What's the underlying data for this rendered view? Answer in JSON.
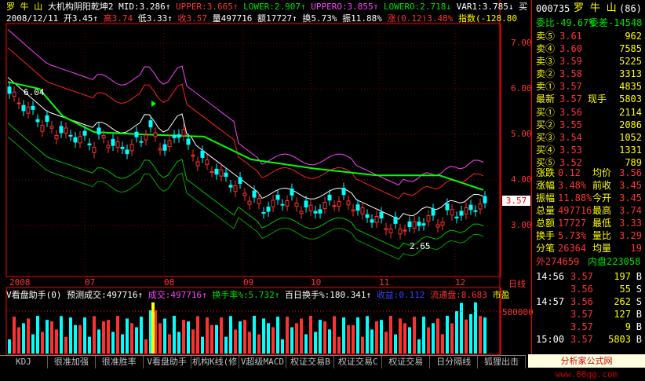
{
  "header": {
    "stock": "罗 牛 山",
    "indicator": "大机构阴阳乾坤2",
    "mid": "MID:3.286↑",
    "upper": "UPPER:3.665↑",
    "lower": "LOWER:2.907↑",
    "uppero": "UPPERO:3.855↑",
    "lowero": "LOWERO:2.718↓",
    "var1": "VAR1:3.785↓",
    "buy": "买",
    "date_line": {
      "date": "2008/12/11",
      "open": "开3.45↑",
      "high": "高3.74",
      "low": "低3.33↑",
      "close": "收3.57",
      "vol": "量497716",
      "amt": "额17727↑",
      "turn": "换5.73%",
      "amp": "振11.88%",
      "chg": "涨(0.12)3.48%",
      "idx": "指数(-128.80"
    }
  },
  "yaxis": [
    "7.00",
    "6.00",
    "5.00",
    "4.00",
    "3.00"
  ],
  "annotations": {
    "high_label": "6.04",
    "low_label": "2.65",
    "price_tag": "3.57"
  },
  "xaxis": [
    "2008",
    "07",
    "08",
    "09",
    "10",
    "11",
    "12"
  ],
  "day_label": "日线",
  "sub": {
    "title": "V看盘助手(0)",
    "pred": "预测成交:497716↑",
    "vol": "成交:497716↑",
    "turn": "换手率%:5.732↑",
    "hundred": "百日换手%:180.341↑",
    "profit": "收益:0.112",
    "float": "流通盘:8.683",
    "city": "市盈",
    "scale": "500000"
  },
  "panel": {
    "code": "000735",
    "name": "罗 牛 山",
    "num": "(86)",
    "wb": "委比-49.67%",
    "wc": "委差-14548",
    "sells": [
      {
        "label": "卖⑤",
        "price": "3.61",
        "vol": "962"
      },
      {
        "label": "卖④",
        "price": "3.60",
        "vol": "7585"
      },
      {
        "label": "卖③",
        "price": "3.59",
        "vol": "5225"
      },
      {
        "label": "卖②",
        "price": "3.58",
        "vol": "3313"
      },
      {
        "label": "卖①",
        "price": "3.57",
        "vol": "4835"
      }
    ],
    "latest": {
      "label": "最新",
      "price": "3.57",
      "lbl2": "现手",
      "vol": "5803"
    },
    "buys": [
      {
        "label": "买①",
        "price": "3.56",
        "vol": "2114"
      },
      {
        "label": "买②",
        "price": "3.55",
        "vol": "2086"
      },
      {
        "label": "买③",
        "price": "3.54",
        "vol": "1052"
      },
      {
        "label": "买④",
        "price": "3.53",
        "vol": "1331"
      },
      {
        "label": "买⑤",
        "price": "3.52",
        "vol": "789"
      }
    ],
    "stats": [
      {
        "a": "涨跌",
        "b": "0.12",
        "c": "均价",
        "d": "3.56"
      },
      {
        "a": "涨幅",
        "b": "3.48%",
        "c": "前收",
        "d": "3.45"
      },
      {
        "a": "振幅",
        "b": "11.88%",
        "c": "今开",
        "d": "3.45"
      },
      {
        "a": "总量",
        "b": "497716",
        "c": "最高",
        "d": "3.74"
      },
      {
        "a": "总额",
        "b": "17727",
        "c": "最低",
        "d": "3.33"
      },
      {
        "a": "换手",
        "b": "5.73%",
        "c": "量比",
        "d": "3.29"
      },
      {
        "a": "分笔",
        "b": "26364",
        "c": "均量",
        "d": "19"
      }
    ],
    "outer": "外274659",
    "inner": "内盘223058",
    "ticks": [
      {
        "t": "14:56",
        "p": "3.57",
        "v": "197",
        "s": "B"
      },
      {
        "t": "",
        "p": "3.56",
        "v": "55",
        "s": "S"
      },
      {
        "t": "14:57",
        "p": "3.56",
        "v": "262",
        "s": "S"
      },
      {
        "t": "",
        "p": "3.57",
        "v": "127",
        "s": "B"
      },
      {
        "t": "",
        "p": "3.57",
        "v": "9",
        "s": "B"
      },
      {
        "t": "15:00",
        "p": "3.57",
        "v": "5803",
        "s": "B"
      }
    ]
  },
  "tabs": [
    "KDJ",
    "很准加强",
    "很准胜率",
    "V看盘助手",
    "机构K线(修",
    "V超级MACD",
    "权证交易B",
    "权证交易C",
    "权证交易",
    "日分隔线",
    "狐狸出击"
  ],
  "brand": "分析家公式网 www.88gg.com"
}
